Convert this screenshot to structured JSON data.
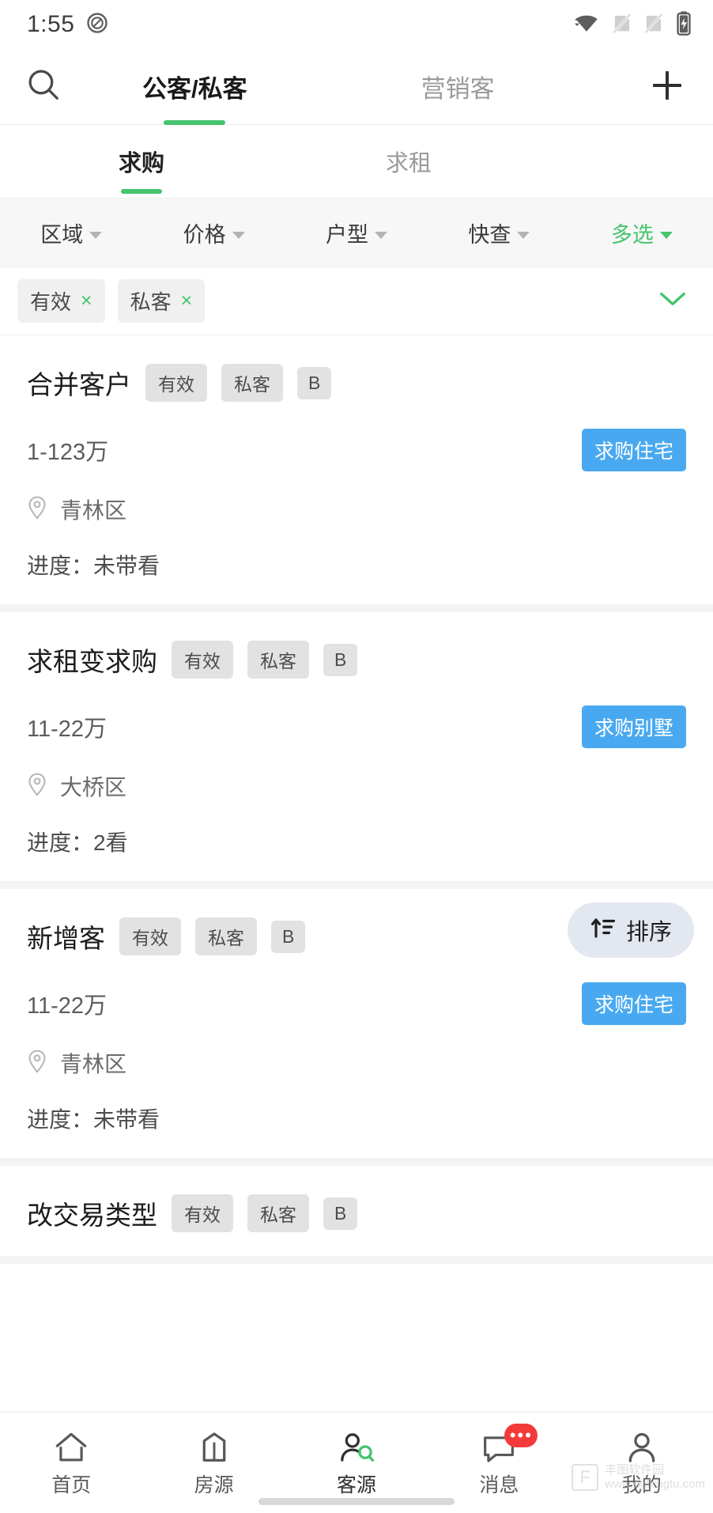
{
  "statusbar": {
    "time": "1:55",
    "icons": [
      "do-not-disturb-icon",
      "wifi-icon",
      "sim-off-icon",
      "sim-off-icon",
      "battery-charging-icon"
    ]
  },
  "topbar": {
    "search_icon": "search-icon",
    "add_icon": "plus-icon",
    "tabs": [
      {
        "label": "公客/私客",
        "active": true
      },
      {
        "label": "营销客",
        "active": false
      }
    ],
    "accent_color": "#44c46c"
  },
  "subtabs": [
    {
      "label": "求购",
      "active": true
    },
    {
      "label": "求租",
      "active": false
    }
  ],
  "filters": [
    {
      "label": "区域",
      "active": false
    },
    {
      "label": "价格",
      "active": false
    },
    {
      "label": "户型",
      "active": false
    },
    {
      "label": "快查",
      "active": false
    },
    {
      "label": "多选",
      "active": true
    }
  ],
  "chips": [
    {
      "label": "有效",
      "remove": "×"
    },
    {
      "label": "私客",
      "remove": "×"
    }
  ],
  "chip_expand_icon": "chevron-down-icon",
  "cards": [
    {
      "title": "合并客户",
      "tags": [
        "有效",
        "私客",
        "B"
      ],
      "price": "1-123万",
      "badge": "求购住宅",
      "location": "青林区",
      "progress": "进度：未带看"
    },
    {
      "title": "求租变求购",
      "tags": [
        "有效",
        "私客",
        "B"
      ],
      "price": "11-22万",
      "badge": "求购别墅",
      "location": "大桥区",
      "progress": "进度：2看"
    },
    {
      "title": "新增客",
      "tags": [
        "有效",
        "私客",
        "B"
      ],
      "price": "11-22万",
      "badge": "求购住宅",
      "location": "青林区",
      "progress": "进度：未带看"
    },
    {
      "title": "改交易类型",
      "tags": [
        "有效",
        "私客",
        "B"
      ],
      "price": "",
      "badge": "",
      "location": "",
      "progress": ""
    }
  ],
  "fab": {
    "label": "排序",
    "icon": "sort-icon"
  },
  "bottomnav": [
    {
      "label": "首页",
      "icon": "home-icon",
      "active": false,
      "badge": ""
    },
    {
      "label": "房源",
      "icon": "building-icon",
      "active": false,
      "badge": ""
    },
    {
      "label": "客源",
      "icon": "customer-icon",
      "active": true,
      "badge": ""
    },
    {
      "label": "消息",
      "icon": "message-icon",
      "active": false,
      "badge": "•••"
    },
    {
      "label": "我的",
      "icon": "profile-icon",
      "active": false,
      "badge": ""
    }
  ],
  "watermark": {
    "mark": "F",
    "line1": "丰图软件园",
    "line2": "www.dgfengtu.com"
  },
  "colors": {
    "green": "#44c46c",
    "blue": "#49a9f0",
    "red": "#f33a3a"
  }
}
